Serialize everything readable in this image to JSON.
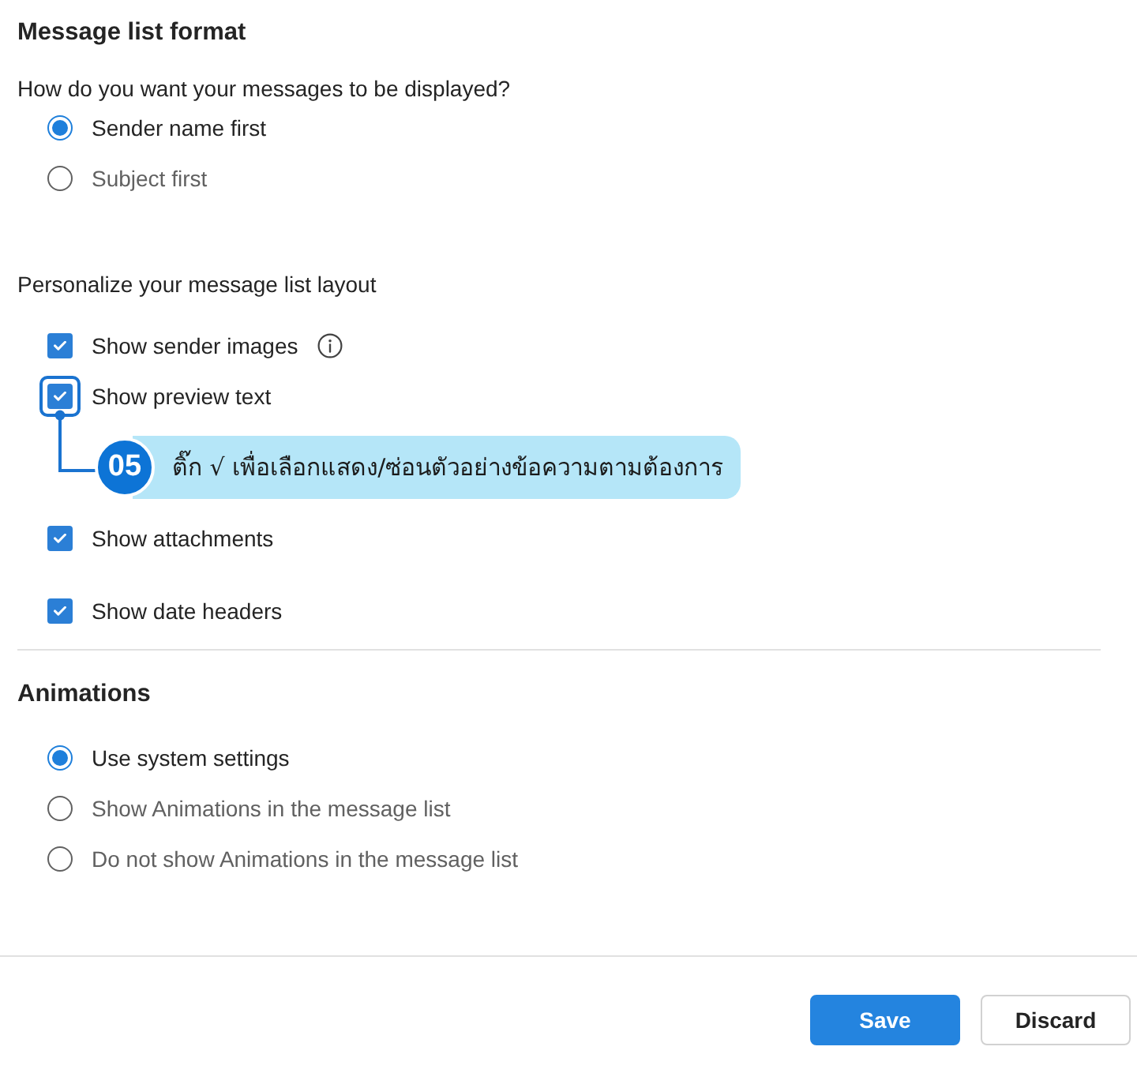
{
  "sections": [
    {
      "title": "Message list format",
      "groups": [
        {
          "prompt": "How do you want your messages to be displayed?",
          "options": [
            {
              "kind": "radio",
              "label": "Sender name first",
              "selected": true
            },
            {
              "kind": "radio",
              "label": "Subject first",
              "selected": false
            }
          ]
        },
        {
          "prompt": "Personalize your message list layout",
          "options": [
            {
              "kind": "checkbox",
              "label": "Show sender images",
              "checked": true,
              "info": true
            },
            {
              "kind": "checkbox",
              "label": "Show preview text",
              "checked": true,
              "callout": {
                "number": "05",
                "text": "ติ๊ก √ เพื่อเลือกแสดง/ซ่อนตัวอย่างข้อความตามต้องการ"
              }
            },
            {
              "kind": "checkbox",
              "label": "Show attachments",
              "checked": true
            },
            {
              "kind": "checkbox",
              "label": "Show date headers",
              "checked": true
            }
          ]
        }
      ]
    },
    {
      "title": "Animations",
      "groups": [
        {
          "options": [
            {
              "kind": "radio",
              "label": "Use system settings",
              "selected": true
            },
            {
              "kind": "radio",
              "label": "Show Animations in the message list",
              "selected": false
            },
            {
              "kind": "radio",
              "label": "Do not show Animations in the message list",
              "selected": false
            }
          ]
        }
      ]
    }
  ],
  "buttons": [
    {
      "label": "Save",
      "kind": "primary"
    },
    {
      "label": "Discard",
      "kind": "secondary"
    }
  ]
}
